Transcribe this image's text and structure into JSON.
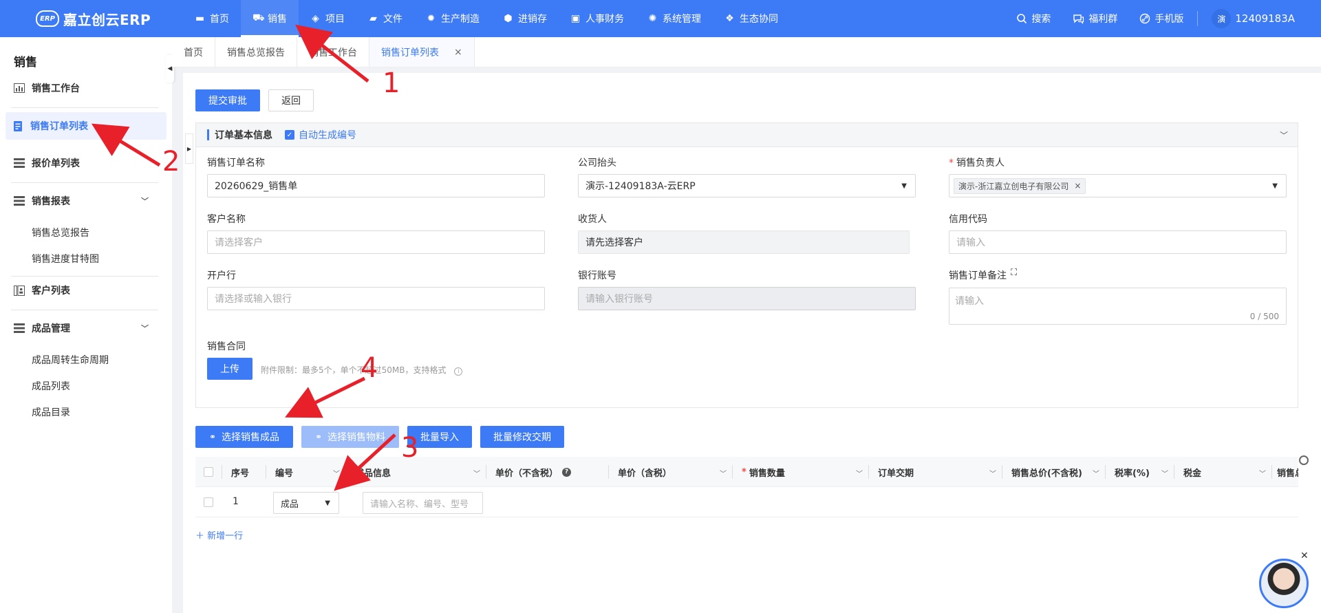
{
  "app": {
    "logo_mark": "ERP",
    "logo_text": "嘉立创云ERP"
  },
  "nav": [
    {
      "label": "首页",
      "icon": "monitor-icon",
      "glyph": "▬"
    },
    {
      "label": "销售",
      "icon": "cart-icon",
      "glyph": "⛟"
    },
    {
      "label": "项目",
      "icon": "layers-icon",
      "glyph": "◈"
    },
    {
      "label": "文件",
      "icon": "folder-icon",
      "glyph": "▰"
    },
    {
      "label": "生产制造",
      "icon": "chip-icon",
      "glyph": "✹"
    },
    {
      "label": "进销存",
      "icon": "box-icon",
      "glyph": "⬢"
    },
    {
      "label": "人事财务",
      "icon": "book-icon",
      "glyph": "▣"
    },
    {
      "label": "系统管理",
      "icon": "gear-icon",
      "glyph": "✺"
    },
    {
      "label": "生态协同",
      "icon": "cluster-icon",
      "glyph": "❖"
    }
  ],
  "top_right": {
    "search": "搜索",
    "welfare": "福利群",
    "mobile": "手机版",
    "avatar_text": "演",
    "user": "12409183A"
  },
  "sidebar": {
    "title": "销售",
    "workbench": "销售工作台",
    "order_list": "销售订单列表",
    "quote_list": "报价单列表",
    "reports": "销售报表",
    "report_overview": "销售总览报告",
    "report_gantt": "销售进度甘特图",
    "customers": "客户列表",
    "products": "成品管理",
    "product_lifecycle": "成品周转生命周期",
    "product_list": "成品列表",
    "product_catalog": "成品目录"
  },
  "tabs": [
    "首页",
    "销售总览报告",
    "销售工作台",
    "销售订单列表"
  ],
  "actions": {
    "submit": "提交审批",
    "back": "返回"
  },
  "section": {
    "title": "订单基本信息",
    "auto_number": "自动生成编号"
  },
  "form": {
    "order_name_label": "销售订单名称",
    "order_name_value": "20260629_销售单",
    "company_label": "公司抬头",
    "company_value": "演示-12409183A-云ERP",
    "owner_label": "销售负责人",
    "owner_tag": "演示-浙江嘉立创电子有限公司",
    "customer_label": "客户名称",
    "customer_placeholder": "请选择客户",
    "consignee_label": "收货人",
    "consignee_value": "请先选择客户",
    "credit_label": "信用代码",
    "credit_placeholder": "请输入",
    "bank_label": "开户行",
    "bank_placeholder": "请选择或输入银行",
    "account_label": "银行账号",
    "account_placeholder": "请输入银行账号",
    "remark_label": "销售订单备注",
    "remark_placeholder": "请输入",
    "remark_counter": "0 / 500",
    "contract_label": "销售合同",
    "upload_button": "上传",
    "upload_hint": "附件限制：最多5个，单个不超过50MB，支持格式"
  },
  "product_actions": {
    "select_product": "选择销售成品",
    "select_material": "选择销售物料",
    "batch_import": "批量导入",
    "batch_edit_date": "批量修改交期"
  },
  "table": {
    "headers": [
      "序号",
      "编号",
      "成品信息",
      "单价（不含税）",
      "单价（含税）",
      "销售数量",
      "订单交期",
      "销售总价(不含税)",
      "税率(%)",
      "税金",
      "销售总价"
    ],
    "row": {
      "index": "1",
      "type": "成品",
      "search_placeholder": "请输入名称、编号、型号"
    },
    "add_row": "新增一行"
  },
  "annotations": [
    "1",
    "2",
    "3",
    "4"
  ],
  "colors": {
    "primary": "#3d7af5",
    "annotation": "#e8202a",
    "required": "#f44444"
  }
}
